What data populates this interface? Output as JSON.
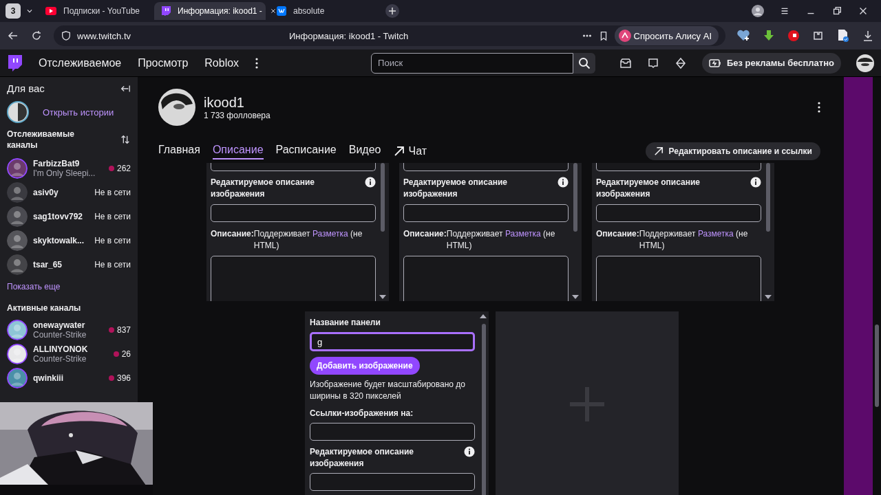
{
  "browser": {
    "tab_count": "3",
    "tabs": [
      {
        "title": "Подписки - YouTube",
        "kind": "youtube",
        "selected": false
      },
      {
        "title": "Информация: ikood1 -",
        "kind": "twitch",
        "selected": true
      },
      {
        "title": "absolute",
        "kind": "vk",
        "selected": false
      }
    ],
    "url": "www.twitch.tv",
    "page_title": "Информация: ikood1 - Twitch",
    "alice_button": "Спросить Алису AI"
  },
  "topnav": {
    "links": [
      "Отслеживаемое",
      "Просмотр",
      "Roblox"
    ],
    "search": {
      "placeholder": "Поиск"
    },
    "promo": "Без рекламы бесплатно"
  },
  "sidebar": {
    "heading": "Для вас",
    "stories": "Открыть истории",
    "followed_heading": "Отслеживаемые каналы",
    "followed": [
      {
        "name": "FarbizzBat9",
        "subtitle": "I'm Only Sleepi...",
        "kind": "live",
        "viewers": "262"
      },
      {
        "name": "asiv0y",
        "kind": "offline",
        "status": "Не в сети"
      },
      {
        "name": "sag1tovv792",
        "kind": "offline",
        "status": "Не в сети"
      },
      {
        "name": "skyktowalk...",
        "kind": "offline",
        "status": "Не в сети"
      },
      {
        "name": "tsar_65",
        "kind": "offline",
        "status": "Не в сети"
      }
    ],
    "show_more": "Показать еще",
    "active_heading": "Активные каналы",
    "active": [
      {
        "name": "onewaywater",
        "subtitle": "Counter-Strike",
        "kind": "live",
        "viewers": "837"
      },
      {
        "name": "ALLINYONOK",
        "subtitle": "Counter-Strike",
        "kind": "live",
        "viewers": "26"
      },
      {
        "name": "qwinkiii",
        "kind": "live",
        "viewers": "396"
      }
    ]
  },
  "channel": {
    "name": "ikood1",
    "followers": "1 733 фолловера",
    "tabs": [
      {
        "label": "Главная",
        "selected": false
      },
      {
        "label": "Описание",
        "selected": true
      },
      {
        "label": "Расписание",
        "selected": false
      },
      {
        "label": "Видео",
        "selected": false
      }
    ],
    "chat": "Чат",
    "edit_button": "Редактировать описание и ссылки"
  },
  "panels": [
    {
      "alt_label": "Редактируемое описание изображения",
      "desc_label": "Описание:",
      "desc_before": "Поддерживает",
      "desc_link": "Разметка",
      "desc_after": "(не HTML)"
    },
    {
      "alt_label": "Редактируемое описание изображения",
      "desc_label": "Описание:",
      "desc_before": "Поддерживает",
      "desc_link": "Разметка",
      "desc_after": "(не HTML)"
    },
    {
      "alt_label": "Редактируемое описание изображения",
      "desc_label": "Описание:",
      "desc_before": "Поддерживает",
      "desc_link": "Разметка",
      "desc_after": "(не HTML)"
    }
  ],
  "new_panel": {
    "title_label": "Название панели",
    "title_value": "g",
    "add_image_button": "Добавить изображение",
    "image_hint": "Изображение будет масштабировано до ширины в 320 пикселей",
    "link_label": "Ссылки-изображения на:",
    "alt_label": "Редактируемое описание изображения"
  }
}
